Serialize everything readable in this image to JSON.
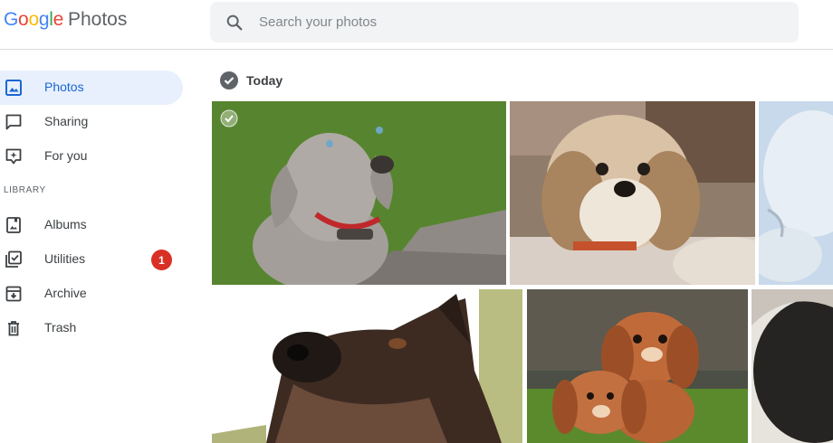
{
  "app": {
    "logo_letters": [
      "G",
      "o",
      "o",
      "g",
      "l",
      "e"
    ],
    "logo_colors": [
      "#4285f4",
      "#ea4335",
      "#fbbc05",
      "#4285f4",
      "#34a853",
      "#ea4335"
    ],
    "product": "Photos"
  },
  "search": {
    "placeholder": "Search your photos",
    "value": "",
    "icon": "search-icon"
  },
  "sidebar": {
    "items": [
      {
        "label": "Photos",
        "icon": "photo-icon",
        "active": true
      },
      {
        "label": "Sharing",
        "icon": "chat-bubble-icon",
        "active": false
      },
      {
        "label": "For you",
        "icon": "sparkle-icon",
        "active": false
      }
    ],
    "library_label": "LIBRARY",
    "library_items": [
      {
        "label": "Albums",
        "icon": "album-icon",
        "active": false
      },
      {
        "label": "Utilities",
        "icon": "checklist-icon",
        "badge": "1",
        "active": false
      },
      {
        "label": "Archive",
        "icon": "archive-icon",
        "active": false
      },
      {
        "label": "Trash",
        "icon": "trash-icon",
        "active": false
      }
    ]
  },
  "main": {
    "date_label": "Today",
    "photos": [
      {
        "name": "photo-weimaraner-puppy"
      },
      {
        "name": "photo-shih-tzu"
      },
      {
        "name": "photo-white-puppy-partial"
      },
      {
        "name": "photo-doberman"
      },
      {
        "name": "photo-cavalier-puppies"
      },
      {
        "name": "photo-dark-dog-partial"
      }
    ]
  },
  "colors": {
    "accent": "#1967d2",
    "active_bg": "#e8f0fe",
    "badge": "#d93025",
    "search_bg": "#f1f3f4"
  }
}
